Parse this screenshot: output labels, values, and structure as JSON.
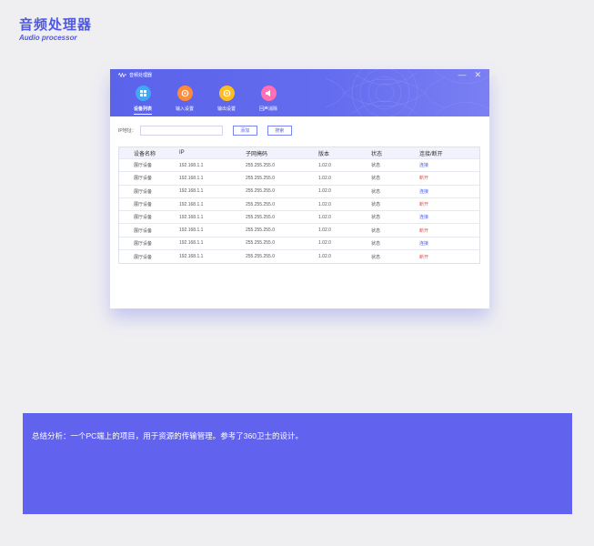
{
  "brand": {
    "title": "音频处理器",
    "subtitle": "Audio processor"
  },
  "window": {
    "title": "音频处理器",
    "controls": {
      "minimize": "—",
      "close": "✕"
    },
    "nav": [
      {
        "label": "设备列表",
        "icon": "device-list-icon",
        "color": "#42a7f5",
        "active": true
      },
      {
        "label": "输入设置",
        "icon": "input-settings-icon",
        "color": "#ff8a3a",
        "active": false
      },
      {
        "label": "输出设置",
        "icon": "output-settings-icon",
        "color": "#ffbd24",
        "active": false
      },
      {
        "label": "回声消除",
        "icon": "echo-cancel-icon",
        "color": "#ff6fb3",
        "active": false
      }
    ],
    "toolbar": {
      "ip_label": "IP地址：",
      "ip_value": "",
      "ip_placeholder": "",
      "add_label": "添加",
      "search_label": "搜索"
    },
    "table": {
      "headers": [
        "设备名称",
        "IP",
        "子网掩码",
        "版本",
        "状态",
        "连接/断开"
      ],
      "rows": [
        {
          "name": "展厅设备",
          "ip": "192.168.1.1",
          "mask": "255.255.255.0",
          "version": "1.02.0",
          "status": "状态",
          "action": "连接",
          "type": "connect"
        },
        {
          "name": "展厅设备",
          "ip": "192.168.1.1",
          "mask": "255.255.255.0",
          "version": "1.02.0",
          "status": "状态",
          "action": "断开",
          "type": "disconnect"
        },
        {
          "name": "展厅设备",
          "ip": "192.168.1.1",
          "mask": "255.255.255.0",
          "version": "1.02.0",
          "status": "状态",
          "action": "连接",
          "type": "connect"
        },
        {
          "name": "展厅设备",
          "ip": "192.168.1.1",
          "mask": "255.255.255.0",
          "version": "1.02.0",
          "status": "状态",
          "action": "断开",
          "type": "disconnect"
        },
        {
          "name": "展厅设备",
          "ip": "192.168.1.1",
          "mask": "255.255.255.0",
          "version": "1.02.0",
          "status": "状态",
          "action": "连接",
          "type": "connect"
        },
        {
          "name": "展厅设备",
          "ip": "192.168.1.1",
          "mask": "255.255.255.0",
          "version": "1.02.0",
          "status": "状态",
          "action": "断开",
          "type": "disconnect"
        },
        {
          "name": "展厅设备",
          "ip": "192.168.1.1",
          "mask": "255.255.255.0",
          "version": "1.02.0",
          "status": "状态",
          "action": "连接",
          "type": "connect"
        },
        {
          "name": "展厅设备",
          "ip": "192.168.1.1",
          "mask": "255.255.255.0",
          "version": "1.02.0",
          "status": "状态",
          "action": "断开",
          "type": "disconnect"
        }
      ]
    }
  },
  "summary": {
    "text": "总结分析：一个PC端上的项目，用于资源的传输管理。参考了360卫士的设计。"
  },
  "colors": {
    "accent": "#5b63ea",
    "connect": "#4f66e6",
    "disconnect": "#f0504f",
    "summary_bg": "#6163ee"
  }
}
